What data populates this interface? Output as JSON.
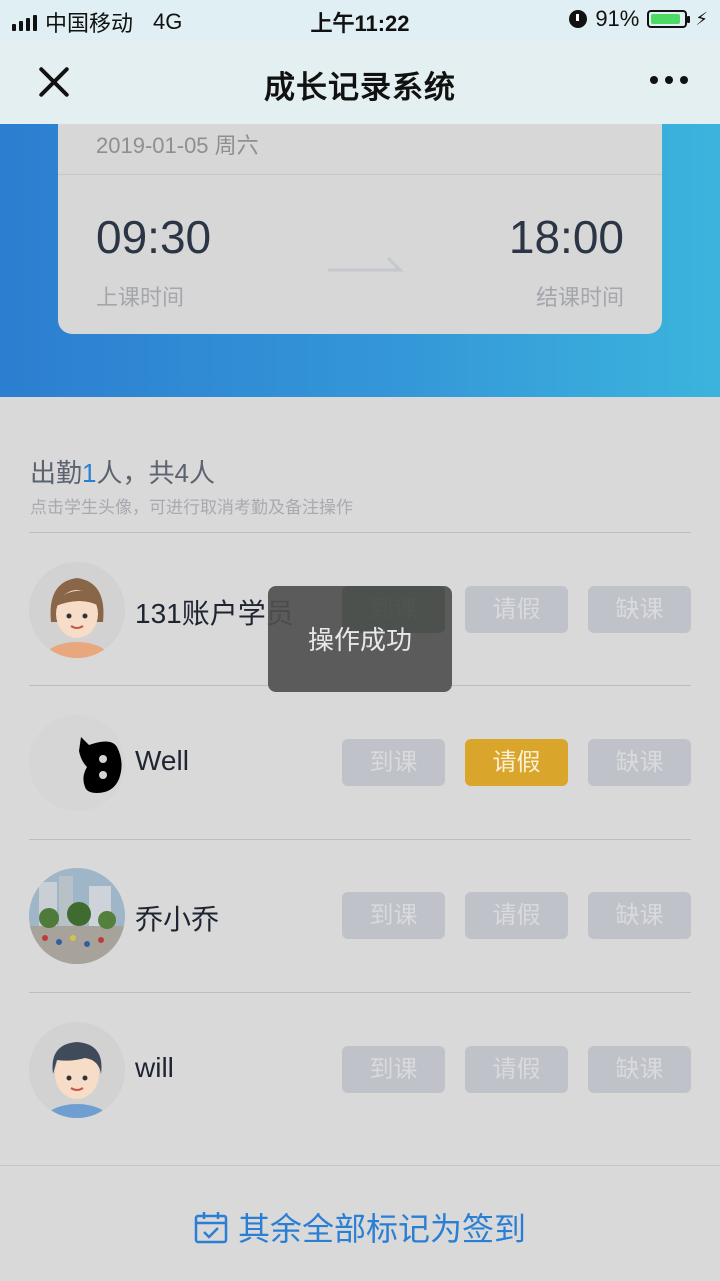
{
  "status_bar": {
    "carrier": "中国移动",
    "network": "4G",
    "time": "上午11:22",
    "battery": "91%"
  },
  "nav": {
    "title": "成长记录系统"
  },
  "lesson": {
    "date": "2019-01-05 周六",
    "start_time": "09:30",
    "start_label": "上课时间",
    "end_time": "18:00",
    "end_label": "结课时间"
  },
  "attendance": {
    "summary_prefix": "出勤",
    "present_count": "1",
    "summary_suffix": "人，共4人",
    "hint": "点击学生头像，可进行取消考勤及备注操作"
  },
  "buttons": {
    "present": "到课",
    "leave": "请假",
    "absent": "缺课"
  },
  "students": [
    {
      "name": "131账户学员",
      "status": "到课"
    },
    {
      "name": "Well",
      "status": "请假"
    },
    {
      "name": "乔小乔",
      "status": ""
    },
    {
      "name": "will",
      "status": ""
    }
  ],
  "toast": "操作成功",
  "footer": {
    "mark_all": "其余全部标记为签到"
  },
  "colors": {
    "accent": "#2a7fd4",
    "present_active": "#1f5a3c",
    "leave_active": "#d9a52a",
    "battery": "#4cd964"
  }
}
